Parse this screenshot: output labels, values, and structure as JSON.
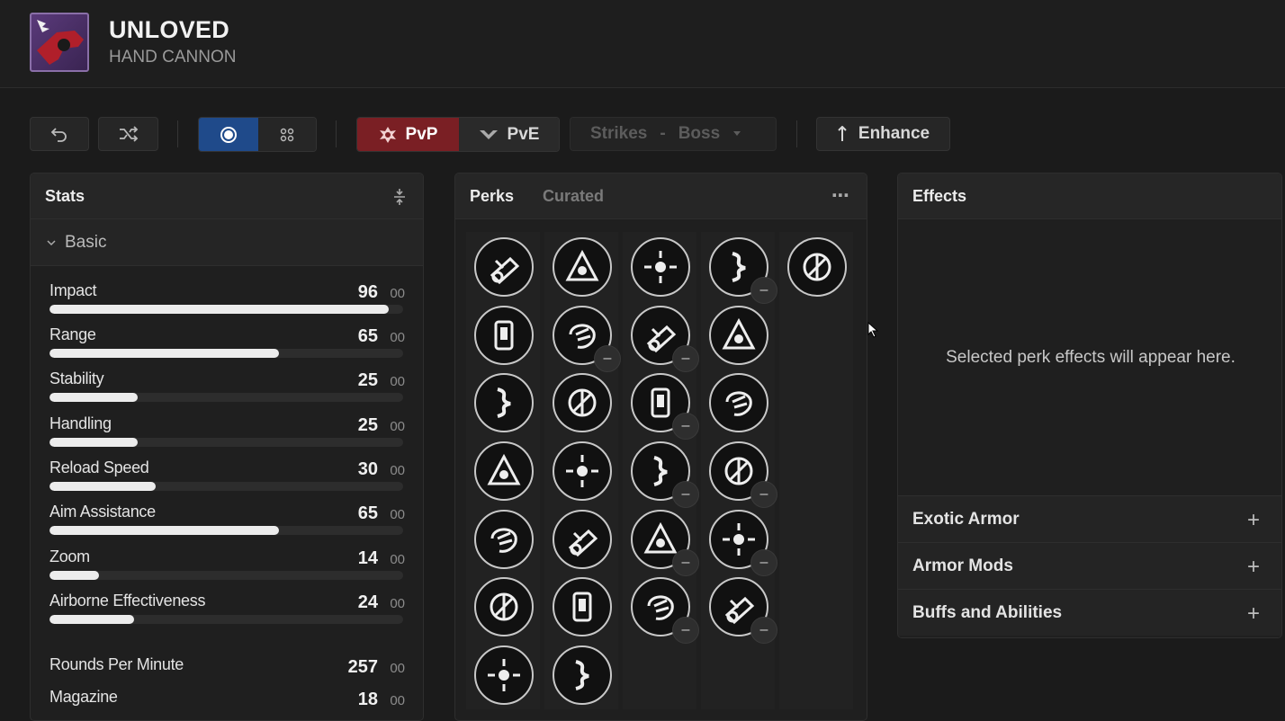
{
  "weapon": {
    "name": "UNLOVED",
    "type": "HAND CANNON",
    "icon": "weapon-thumbnail"
  },
  "toolbar": {
    "undo_icon": "undo-icon",
    "random_icon": "shuffle-icon",
    "view_single_icon": "single-view-icon",
    "view_grid_icon": "grid-view-icon",
    "mode_pvp": "PvP",
    "mode_pve": "PvE",
    "activity_select": "Strikes",
    "activity_dash": "-",
    "difficulty_select": "Boss",
    "enhance_label": "Enhance",
    "active_mode": "PvP",
    "accent_pvp": "#7a1f24",
    "accent_view": "#1f4a8a"
  },
  "stats": {
    "title": "Stats",
    "section": "Basic",
    "items": [
      {
        "name": "Impact",
        "value": "96",
        "bonus": "00",
        "fill": 0.96
      },
      {
        "name": "Range",
        "value": "65",
        "bonus": "00",
        "fill": 0.65
      },
      {
        "name": "Stability",
        "value": "25",
        "bonus": "00",
        "fill": 0.25
      },
      {
        "name": "Handling",
        "value": "25",
        "bonus": "00",
        "fill": 0.25
      },
      {
        "name": "Reload Speed",
        "value": "30",
        "bonus": "00",
        "fill": 0.3
      },
      {
        "name": "Aim Assistance",
        "value": "65",
        "bonus": "00",
        "fill": 0.65
      },
      {
        "name": "Zoom",
        "value": "14",
        "bonus": "00",
        "fill": 0.14
      },
      {
        "name": "Airborne Effectiveness",
        "value": "24",
        "bonus": "00",
        "fill": 0.24
      }
    ],
    "extra": [
      {
        "name": "Rounds Per Minute",
        "value": "257",
        "bonus": "00"
      },
      {
        "name": "Magazine",
        "value": "18",
        "bonus": "00"
      }
    ]
  },
  "perks": {
    "title": "Perks",
    "tab_curated": "Curated",
    "more_icon": "more-icon",
    "columns": [
      [
        "barrel-icon",
        "barrel-icon",
        "barrel-icon",
        "barrel-icon",
        "barrel-icon",
        "barrel-icon",
        "barrel-icon"
      ],
      [
        "magazine-icon",
        "magazine-icon",
        "magazine-icon",
        "magazine-icon",
        "magazine-icon",
        "magazine-icon",
        "magazine-icon"
      ],
      [
        "trait-icon",
        "trait-icon",
        "trait-icon",
        "trait-icon",
        "trait-icon",
        "trait-icon"
      ],
      [
        "trait-icon",
        "trait-icon",
        "trait-icon",
        "trait-icon",
        "trait-icon",
        "trait-icon"
      ],
      [
        "origin-icon"
      ]
    ]
  },
  "effects": {
    "title": "Effects",
    "empty_message": "Selected perk effects will appear here.",
    "sections": [
      {
        "label": "Exotic Armor"
      },
      {
        "label": "Armor Mods"
      },
      {
        "label": "Buffs and Abilities"
      }
    ]
  }
}
